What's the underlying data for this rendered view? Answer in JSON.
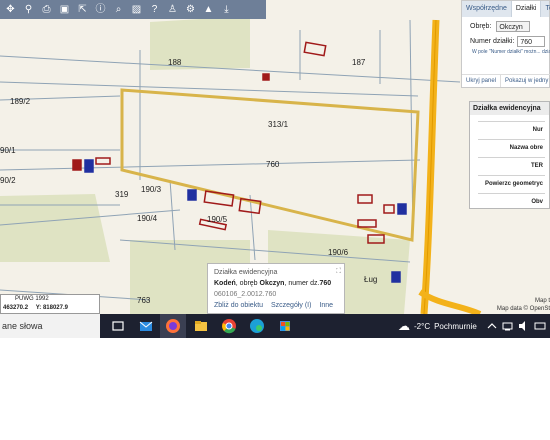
{
  "map": {
    "parcel_labels": [
      "188",
      "187",
      "189/2",
      "313/1",
      "760",
      "90/1",
      "90/2",
      "190/3",
      "319",
      "190/4",
      "190/5",
      "190/6",
      "763",
      "Ług"
    ],
    "colors": {
      "background": "#f4f1e8",
      "selected_parcel": "#d8b44a",
      "buildings": "#a01a1a",
      "road": "#f3b21a",
      "fields": "#dfe3c3"
    }
  },
  "toolbar": {
    "icons": [
      "pan-icon",
      "measure-icon",
      "print-icon",
      "save-icon",
      "export-icon",
      "info-icon",
      "search-icon",
      "stripes-icon",
      "help-icon",
      "person-icon",
      "settings-icon",
      "mountain-icon",
      "download-icon"
    ]
  },
  "right_panel": {
    "tabs": [
      "Współrzędne",
      "Działki",
      "Tere"
    ],
    "obreb_label": "Obręb:",
    "obreb_value": "Okczyn",
    "numer_label": "Numer działki:",
    "numer_value": "760",
    "hint": "W pole \"Numer działki\" możn... działki.",
    "link_hide": "Ukryj panel",
    "link_show": "Pokazuj w jedny"
  },
  "dzialka_panel": {
    "title": "Działka ewidencyjna",
    "rows": [
      "Nur",
      "Nazwa obre",
      "TER",
      "Powierzc geometryc",
      "Obv"
    ]
  },
  "coords": {
    "system": "PUWG 1992",
    "x_label": "X:",
    "x_value": "463270.2",
    "y_label": "Y:",
    "y_value": "818027.9"
  },
  "popup": {
    "title": "Działka ewidencyjna",
    "place": "Kodeń",
    "obreb_text": ", obręb ",
    "obreb": "Okczyn",
    "numer_text": ", numer dz.",
    "numer": "760",
    "identifier": "060106_2.0012.760",
    "link_zoom": "Zbliż do obiektu",
    "link_details": "Szczegóły (I)",
    "link_other": "Inne"
  },
  "attribution": {
    "line1": "Map t",
    "line2": "Map data © OpenSt"
  },
  "taskbar": {
    "search_text": "ane słowa",
    "temperature": "-2°C",
    "weather": "Pochmurnie"
  }
}
